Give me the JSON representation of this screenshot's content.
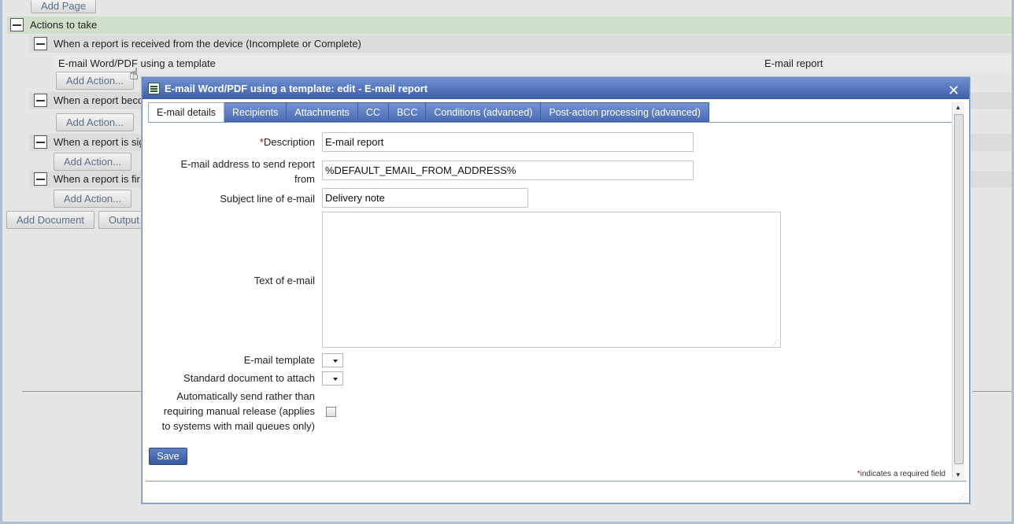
{
  "background": {
    "add_page_button": "Add Page",
    "actions_header": "Actions to take",
    "trigger_received": "When a report is received from the device (Incomplete or Complete)",
    "action_row_label": "E-mail Word/PDF using a template",
    "action_row_value": "E-mail report",
    "add_action_button": "Add Action...",
    "trigger_becomes": "When a report beco",
    "trigger_signed": "When a report is sig",
    "trigger_final": "When a report is fir",
    "add_document_button": "Add Document",
    "output_button": "Output f"
  },
  "dialog": {
    "title": "E-mail Word/PDF using a template: edit - E-mail report",
    "close_glyph": "✕",
    "tabs": [
      "E-mail details",
      "Recipients",
      "Attachments",
      "CC",
      "BCC",
      "Conditions (advanced)",
      "Post-action processing (advanced)"
    ],
    "active_tab": "E-mail details",
    "form": {
      "required_mark": "*",
      "description_label": "Description",
      "description_value": "E-mail report",
      "from_label_line1": "E-mail address to send report",
      "from_label_line2": "from",
      "from_value": "%DEFAULT_EMAIL_FROM_ADDRESS%",
      "subject_label": "Subject line of e-mail",
      "subject_value": "Delivery note",
      "text_label": "Text of e-mail",
      "template_label": "E-mail template",
      "standard_doc_label": "Standard document to attach",
      "auto_send_line1": "Automatically send rather than",
      "auto_send_line2": "requiring manual release (applies",
      "auto_send_line3": "to systems with mail queues only)",
      "auto_send_checked": false
    },
    "save_label": "Save",
    "required_note": "indicates a required field"
  },
  "colors": {
    "titlebar": "#4a6cb3",
    "tab": "#5a7cc2",
    "actions_row_bg": "#c9dbc4",
    "required": "#cc0000"
  }
}
